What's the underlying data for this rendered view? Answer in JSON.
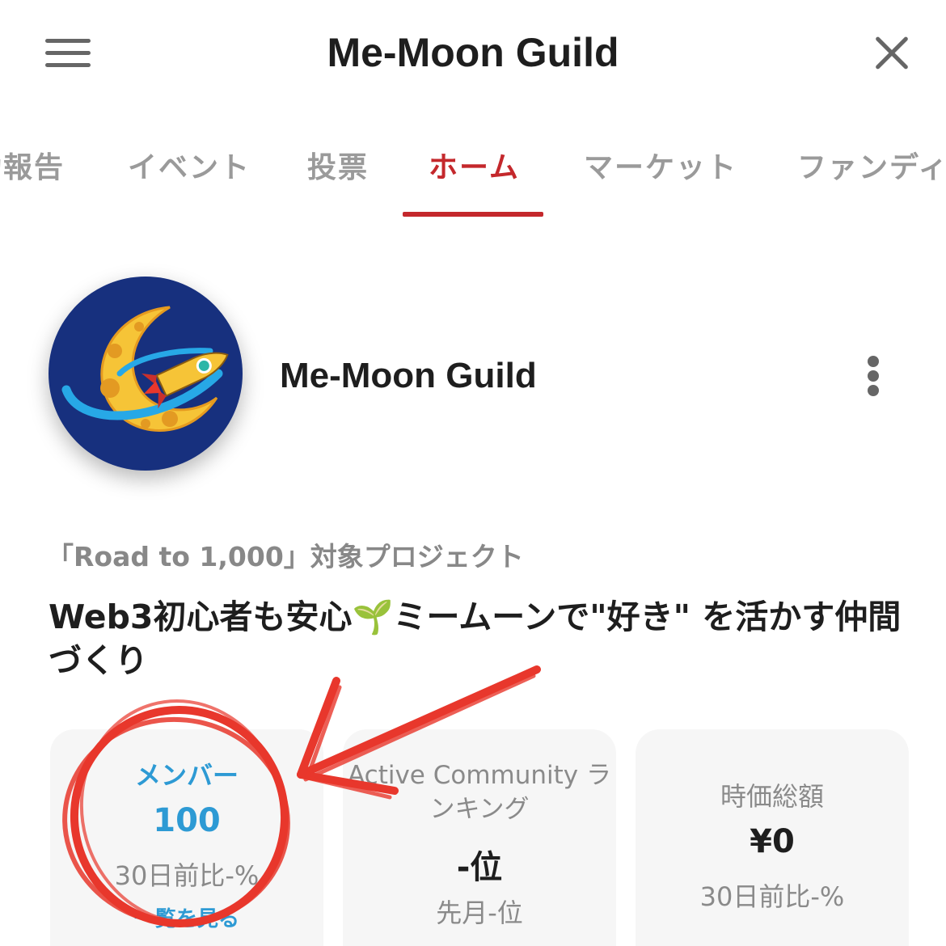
{
  "header": {
    "title": "Me-Moon Guild",
    "menu_icon": "hamburger-menu-icon",
    "close_icon": "close-icon"
  },
  "tabs": [
    {
      "label": "活動報告",
      "active": false
    },
    {
      "label": "イベント",
      "active": false
    },
    {
      "label": "投票",
      "active": false
    },
    {
      "label": "ホーム",
      "active": true
    },
    {
      "label": "マーケット",
      "active": false
    },
    {
      "label": "ファンディング",
      "active": false
    }
  ],
  "profile": {
    "avatar_icon": "moon-rocket-logo",
    "name": "Me-Moon Guild",
    "more_icon": "more-vertical-icon"
  },
  "project_label": "「Road to 1,000」対象プロジェクト",
  "description": "Web3初心者も安心🌱ミームーンで\"好き\" を活かす仲間づくり",
  "stats": [
    {
      "label": "メンバー",
      "value": "100",
      "sub": "30日前比-%",
      "link": "一覧を見る"
    },
    {
      "label": "Active Community ランキング",
      "value": "-位",
      "sub": "先月-位"
    },
    {
      "label": "時価総額",
      "value": "¥0",
      "sub": "30日前比-%"
    }
  ],
  "colors": {
    "accent_red": "#c4282c",
    "member_blue": "#2d9ad4",
    "annotation_red": "#e8372c",
    "avatar_bg": "#17307e"
  }
}
